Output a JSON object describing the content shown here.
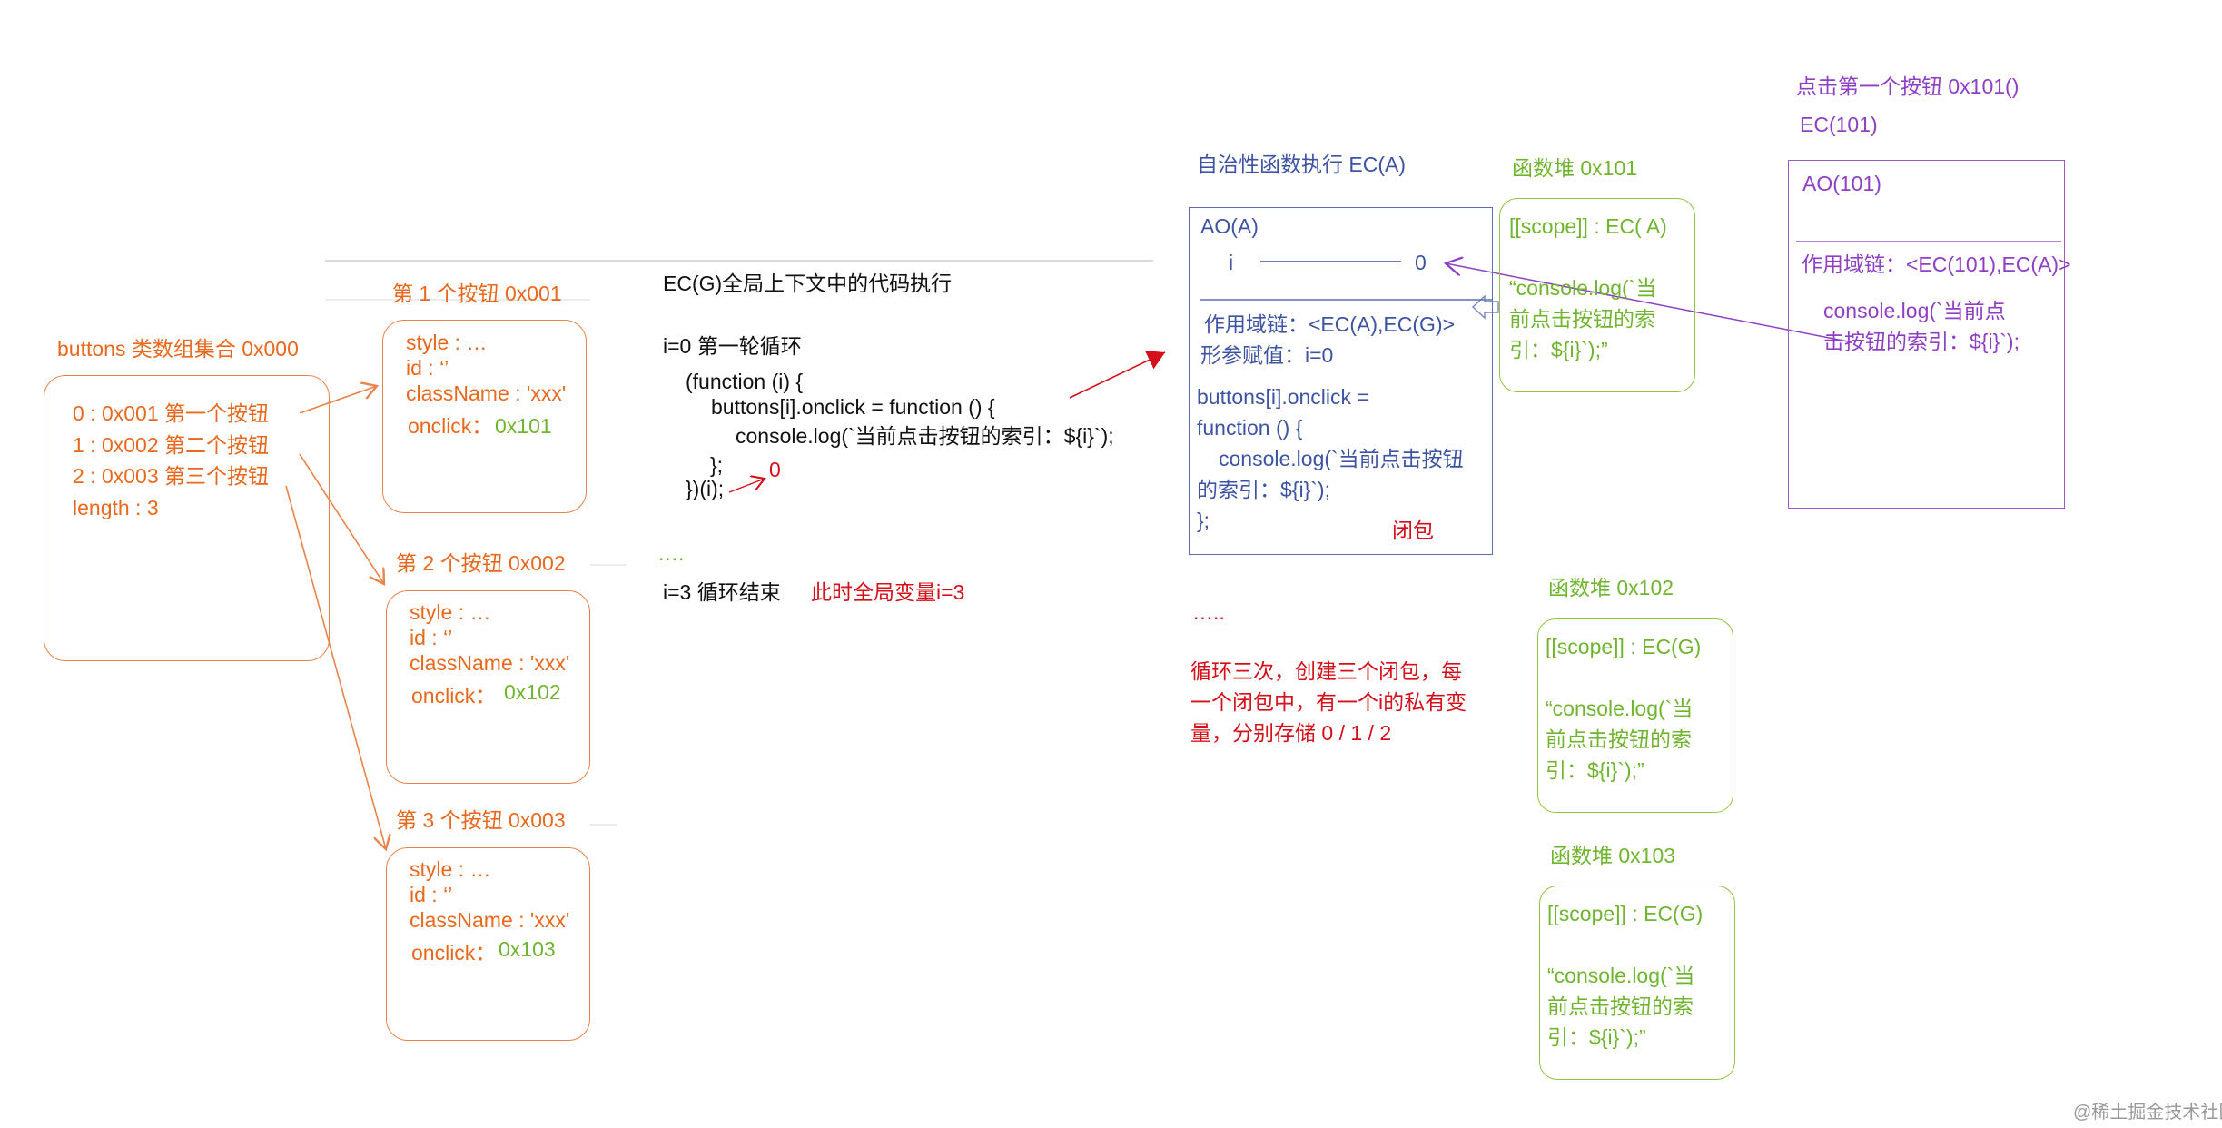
{
  "buttons_array": {
    "title": "buttons 类数组集合 0x000",
    "items": [
      "0 : 0x001  第一个按钮",
      "1 : 0x002  第二个按钮",
      "2 : 0x003  第三个按钮",
      "length : 3"
    ]
  },
  "button_objects": [
    {
      "title": "第 1 个按钮 0x001",
      "style": "style : …",
      "id": "id : ‘’",
      "className": "className : 'xxx'",
      "onclick_label": "onclick：",
      "onclick_value": "0x101"
    },
    {
      "title": "第 2 个按钮 0x002",
      "style": "style : …",
      "id": "id : ‘’",
      "className": "className : 'xxx'",
      "onclick_label": "onclick：",
      "onclick_value": "0x102"
    },
    {
      "title": "第 3 个按钮 0x003",
      "style": "style : …",
      "id": "id : ‘’",
      "className": "className : 'xxx'",
      "onclick_label": "onclick：",
      "onclick_value": "0x103"
    }
  ],
  "global_code": {
    "title": "EC(G)全局上下文中的代码执行",
    "loop_first": "i=0   第一轮循环",
    "code_lines": [
      "(function (i) {",
      "buttons[i].onclick = function () {",
      "console.log(`当前点击按钮的索引：${i}`);",
      "};",
      "})(i);"
    ],
    "arg_value": "0",
    "ellipsis": "….",
    "loop_end": "i=3   循环结束",
    "loop_end_note": "此时全局变量i=3"
  },
  "ec_a": {
    "title": "自治性函数执行 EC(A)",
    "ao_label": "AO(A)",
    "var_name": "i",
    "var_value": "0",
    "scope_chain": "作用域链：<EC(A),EC(G)>",
    "param_assign": "形参赋值：i=0",
    "code_lines": [
      "buttons[i].onclick =",
      "function () {",
      "console.log(`当前点击按钮",
      "的索引：${i}`);",
      "};"
    ],
    "closure_label": "闭包",
    "ellipsis": "…..",
    "summary_lines": [
      "循环三次，创建三个闭包，每",
      "一个闭包中，有一个i的私有变",
      "量，分别存储 0 / 1 / 2"
    ]
  },
  "heaps": [
    {
      "title": "函数堆 0x101",
      "scope": "[[scope]] : EC( A)",
      "code_lines": [
        "“console.log(`当",
        "前点击按钮的索",
        "引：${i}`);”"
      ]
    },
    {
      "title": "函数堆 0x102",
      "scope": "[[scope]] : EC(G)",
      "code_lines": [
        "“console.log(`当",
        "前点击按钮的索",
        "引：${i}`);”"
      ]
    },
    {
      "title": "函数堆 0x103",
      "scope": "[[scope]] : EC(G)",
      "code_lines": [
        "“console.log(`当",
        "前点击按钮的索",
        "引：${i}`);”"
      ]
    }
  ],
  "ec_101": {
    "click_title": "点击第一个按钮  0x101()",
    "title": "EC(101)",
    "ao_label": "AO(101)",
    "scope_chain": "作用域链：<EC(101),EC(A)>",
    "code_lines": [
      "console.log(`当前点",
      "击按钮的索引：${i}`);"
    ]
  },
  "watermark": "@稀土掘金技术社区",
  "colors": {
    "orange": "#e8691e",
    "green": "#6fb52f",
    "blue": "#3e54a3",
    "purple": "#8e3fc4",
    "red": "#d4101a"
  }
}
